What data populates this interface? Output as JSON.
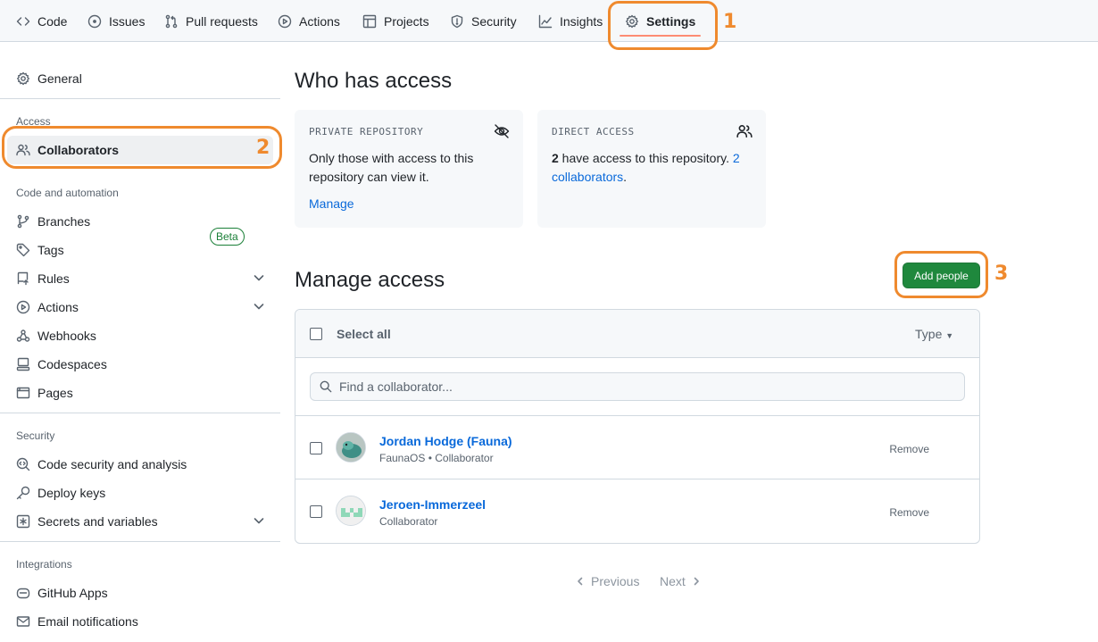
{
  "nav": {
    "tabs": [
      {
        "label": "Code",
        "icon": "code-icon"
      },
      {
        "label": "Issues",
        "icon": "issue-opened-icon"
      },
      {
        "label": "Pull requests",
        "icon": "git-pull-request-icon"
      },
      {
        "label": "Actions",
        "icon": "play-icon"
      },
      {
        "label": "Projects",
        "icon": "table-icon"
      },
      {
        "label": "Security",
        "icon": "shield-icon"
      },
      {
        "label": "Insights",
        "icon": "graph-icon"
      },
      {
        "label": "Settings",
        "icon": "gear-icon"
      }
    ],
    "selected": "Settings"
  },
  "annotations": [
    "1",
    "2",
    "3"
  ],
  "annotation_color": "#ef8a2e",
  "sidebar": {
    "general": "General",
    "access_heading": "Access",
    "collaborators": "Collaborators",
    "code_heading": "Code and automation",
    "branches": "Branches",
    "tags": "Tags",
    "rules": "Rules",
    "beta": "Beta",
    "actions": "Actions",
    "webhooks": "Webhooks",
    "codespaces": "Codespaces",
    "pages": "Pages",
    "security_heading": "Security",
    "code_security": "Code security and analysis",
    "deploy_keys": "Deploy keys",
    "secrets": "Secrets and variables",
    "integrations_heading": "Integrations",
    "github_apps": "GitHub Apps",
    "email_notifications": "Email notifications"
  },
  "who_has_access": {
    "title": "Who has access",
    "private_card": {
      "title": "PRIVATE REPOSITORY",
      "text": "Only those with access to this repository can view it.",
      "link": "Manage",
      "icon": "eye-closed-icon"
    },
    "direct_card": {
      "title": "DIRECT ACCESS",
      "count": "2",
      "text": " have access to this repository. ",
      "link": "2 collaborators",
      "suffix": ".",
      "icon": "people-icon"
    }
  },
  "manage_access": {
    "title": "Manage access",
    "add_button": "Add people",
    "select_all": "Select all",
    "type_filter": "Type",
    "search_placeholder": "Find a collaborator...",
    "collaborators": [
      {
        "name": "Jordan Hodge (Fauna)",
        "role": "FaunaOS • Collaborator",
        "remove": "Remove"
      },
      {
        "name": "Jeroen-Immerzeel",
        "role": "Collaborator",
        "remove": "Remove"
      }
    ]
  },
  "pagination": {
    "previous": "Previous",
    "next": "Next"
  },
  "colors": {
    "primary_button": "#1f883d",
    "link": "#0969da",
    "selected_tab_underline": "#fd8c73"
  }
}
